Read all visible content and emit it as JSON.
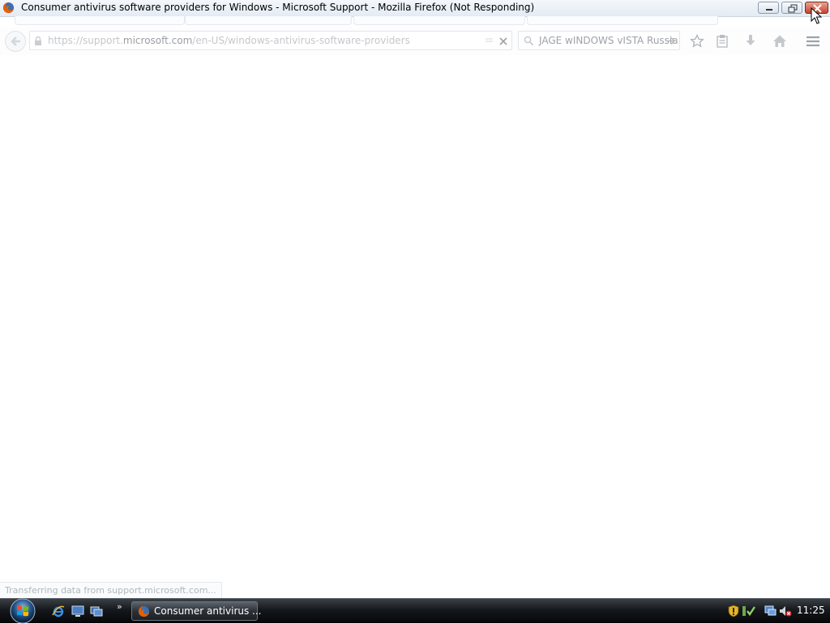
{
  "window": {
    "title": "Consumer antivirus software providers for Windows - Microsoft Support - Mozilla Firefox (Not Responding)"
  },
  "navbar": {
    "url_prefix": "https://support.",
    "url_host": "microsoft.com",
    "url_path": "/en-US/windows-antivirus-software-providers",
    "search_value": "JAGE wINDOWS vISTA Russia"
  },
  "status": {
    "text": "Transferring data from support.microsoft.com..."
  },
  "taskbar": {
    "quicklaunch_more": "»",
    "task_label": "Consumer antivirus ...",
    "clock": "11:25"
  },
  "colors": {
    "firefox_orange": "#e66000",
    "close_red": "#c7432b",
    "taskbar_dark": "#15181c"
  }
}
